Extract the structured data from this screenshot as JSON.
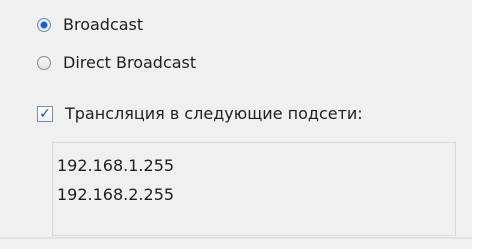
{
  "options": {
    "broadcast_label": "Broadcast",
    "direct_broadcast_label": "Direct Broadcast",
    "selected": "Broadcast"
  },
  "subnets": {
    "checkbox_label": "Трансляция в следующие подсети:",
    "checked": true,
    "items": [
      "192.168.1.255",
      "192.168.2.255"
    ]
  },
  "icons": {
    "selected_radio": "radio-selected-icon",
    "unselected_radio": "radio-unselected-icon",
    "checkbox": "checkbox-checked-icon"
  },
  "colors": {
    "panel_bg": "#f0f0f0",
    "accent_blue": "#0f61c9",
    "checkbox_mark": "#1e4f98"
  }
}
